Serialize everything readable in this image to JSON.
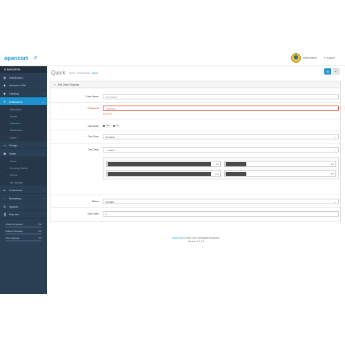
{
  "brand": {
    "name": "opencart",
    "cart_glyph": "↺"
  },
  "header": {
    "user_name": "admin admin",
    "logout_icon": "sign-out-icon",
    "logout_label": "Logout"
  },
  "sidebar": {
    "heading": "NAVIGATION",
    "items": [
      {
        "label": "Dashboard",
        "icon": "dashboard-icon",
        "glyph": "▦",
        "active": false,
        "chevron": ""
      },
      {
        "label": "Advance Utils",
        "icon": "tag-icon",
        "glyph": "◆",
        "active": false,
        "chevron": "›"
      },
      {
        "label": "Catalog",
        "icon": "tag-icon",
        "glyph": "◆",
        "active": false,
        "chevron": "›"
      },
      {
        "label": "Extensions",
        "icon": "puzzle-icon",
        "glyph": "✦",
        "active": true,
        "chevron": "⌄"
      }
    ],
    "extensions_sub": [
      {
        "label": "Marketplace",
        "current": false
      },
      {
        "label": "Installer",
        "current": false
      },
      {
        "label": "Extensions",
        "current": true
      },
      {
        "label": "Modifications",
        "current": false
      },
      {
        "label": "Events",
        "current": false
      }
    ],
    "items2": [
      {
        "label": "Design",
        "icon": "monitor-icon",
        "glyph": "▭",
        "chevron": "›"
      },
      {
        "label": "Sales",
        "icon": "cart-icon",
        "glyph": "▣",
        "chevron": "⌄"
      }
    ],
    "sales_sub": [
      {
        "label": "Orders"
      },
      {
        "label": "Recurring Profiles"
      },
      {
        "label": "Returns"
      },
      {
        "label": "Gift Vouchers"
      }
    ],
    "items3": [
      {
        "label": "Customers",
        "icon": "user-icon",
        "glyph": "●",
        "chevron": "›"
      },
      {
        "label": "Marketing",
        "icon": "share-icon",
        "glyph": "∴",
        "chevron": "›"
      },
      {
        "label": "System",
        "icon": "gear-icon",
        "glyph": "⚙",
        "chevron": "›"
      },
      {
        "label": "Reports",
        "icon": "bar-chart-icon",
        "glyph": "▐",
        "chevron": "›"
      }
    ],
    "progress": [
      {
        "label": "Orders Completed",
        "percent": 0,
        "color": "#8fbb6c",
        "pct_label": "0%"
      },
      {
        "label": "Orders Processing",
        "percent": 0,
        "color": "#f3a638",
        "pct_label": "0%"
      },
      {
        "label": "Other Statuses",
        "percent": 0,
        "color": "#e3503e",
        "pct_label": "0%"
      }
    ]
  },
  "page": {
    "title": "Quick",
    "breadcrumb": [
      "Home",
      "Extensions",
      "Quick"
    ],
    "breadcrumb_sep": "›",
    "save_icon": "save-icon",
    "save_glyph": "▤",
    "back_icon": "reply-icon",
    "back_glyph": "↶"
  },
  "panel": {
    "pencil_glyph": "✎",
    "heading": "Edit Quick Shipping"
  },
  "form": {
    "username": {
      "label": "User Name",
      "required": true,
      "placeholder": "User Name",
      "value": ""
    },
    "password": {
      "label": "Password",
      "required": true,
      "placeholder": "Password",
      "value": "",
      "error": "Required!"
    },
    "test_mode": {
      "label": "Test Mode",
      "options": [
        "Yes",
        "No"
      ],
      "selected": "Yes"
    },
    "geo_zone": {
      "label": "Geo Zone",
      "value": "All Zones"
    },
    "tax_class": {
      "label": "Tax Class",
      "value": " --- None --- "
    },
    "tax_rows": [
      {
        "left_suffix": "fee",
        "right_suffix": "Fld"
      },
      {
        "left_suffix": "ekg",
        "right_suffix": "Fld"
      }
    ],
    "status": {
      "label": "Status",
      "value": "Enabled"
    },
    "sort_order": {
      "label": "Sort Order",
      "value": "2"
    }
  },
  "footer": {
    "brand": "OpenCart",
    "copyright": " © 2009-2021 All Rights Reserved.",
    "version": "Version 3.0.3.8"
  }
}
